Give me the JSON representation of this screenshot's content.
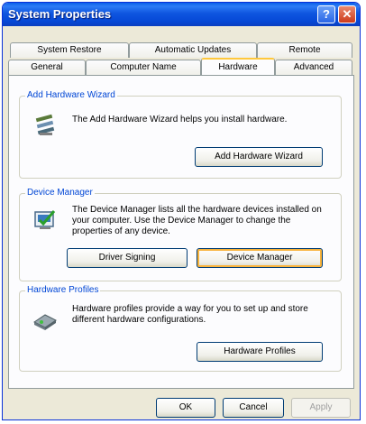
{
  "window": {
    "title": "System Properties"
  },
  "titlebar": {
    "help_glyph": "?",
    "close_glyph": "✕"
  },
  "tabs": {
    "row1": [
      {
        "label": "System Restore"
      },
      {
        "label": "Automatic Updates"
      },
      {
        "label": "Remote"
      }
    ],
    "row2": [
      {
        "label": "General"
      },
      {
        "label": "Computer Name"
      },
      {
        "label": "Hardware",
        "active": true
      },
      {
        "label": "Advanced"
      }
    ]
  },
  "groups": {
    "add_hardware": {
      "label": "Add Hardware Wizard",
      "text": "The Add Hardware Wizard helps you install hardware.",
      "button": "Add Hardware Wizard",
      "icon": "add-hardware-wizard-icon"
    },
    "device_manager": {
      "label": "Device Manager",
      "text": "The Device Manager lists all the hardware devices installed on your computer. Use the Device Manager to change the properties of any device.",
      "driver_signing_button": "Driver Signing",
      "device_manager_button": "Device Manager",
      "icon": "device-manager-icon"
    },
    "hardware_profiles": {
      "label": "Hardware Profiles",
      "text": "Hardware profiles provide a way for you to set up and store different hardware configurations.",
      "button": "Hardware Profiles",
      "icon": "hardware-profiles-icon"
    }
  },
  "footer": {
    "ok": "OK",
    "cancel": "Cancel",
    "apply": "Apply"
  },
  "colors": {
    "titlebar": "#0a5fe9",
    "group_label": "#0046d5",
    "tab_highlight": "#ffc83c",
    "dialog_bg": "#ece9d8"
  }
}
